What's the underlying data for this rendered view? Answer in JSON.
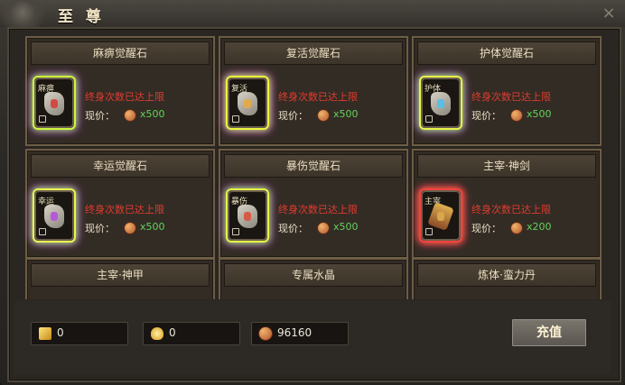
{
  "window": {
    "title": "至 尊",
    "close_icon": "×"
  },
  "items": [
    {
      "name": "麻痹觉醒石",
      "tag": "麻痹",
      "status": "终身次数已达上限",
      "price_label": "现价：",
      "price": "x500",
      "glow": "#d7ff3f",
      "mark": "#d34a44",
      "icon": "paralysis-stone-icon"
    },
    {
      "name": "复活觉醒石",
      "tag": "复活",
      "status": "终身次数已达上限",
      "price_label": "现价：",
      "price": "x500",
      "glow": "#f8ff3d",
      "mark": "#e2a94c",
      "icon": "revive-stone-icon"
    },
    {
      "name": "护体觉醒石",
      "tag": "护体",
      "status": "终身次数已达上限",
      "price_label": "现价：",
      "price": "x500",
      "glow": "#f2ff4c",
      "mark": "#58bfe5",
      "icon": "guard-stone-icon"
    },
    {
      "name": "幸运觉醒石",
      "tag": "幸运",
      "status": "终身次数已达上限",
      "price_label": "现价：",
      "price": "x500",
      "glow": "#f5ff53",
      "mark": "#b45ad8",
      "icon": "luck-stone-icon"
    },
    {
      "name": "暴伤觉醒石",
      "tag": "暴伤",
      "status": "终身次数已达上限",
      "price_label": "现价：",
      "price": "x500",
      "glow": "#f1ff45",
      "mark": "#d65a45",
      "icon": "crit-stone-icon"
    },
    {
      "name": "主宰·神剑",
      "tag": "主宰",
      "status": "终身次数已达上限",
      "price_label": "现价：",
      "price": "x200",
      "glow": "#ff453e",
      "mark": "#d8a64b",
      "icon": "sword-icon"
    },
    {
      "name": "主宰·神甲",
      "icon": "armor-icon"
    },
    {
      "name": "专属水晶",
      "icon": "crystal-icon"
    },
    {
      "name": "炼体·蛮力丹",
      "icon": "pill-icon"
    }
  ],
  "footer": {
    "gold_bar_value": "0",
    "ingot_value": "0",
    "coin_value": "96160",
    "recharge_label": "充值"
  }
}
